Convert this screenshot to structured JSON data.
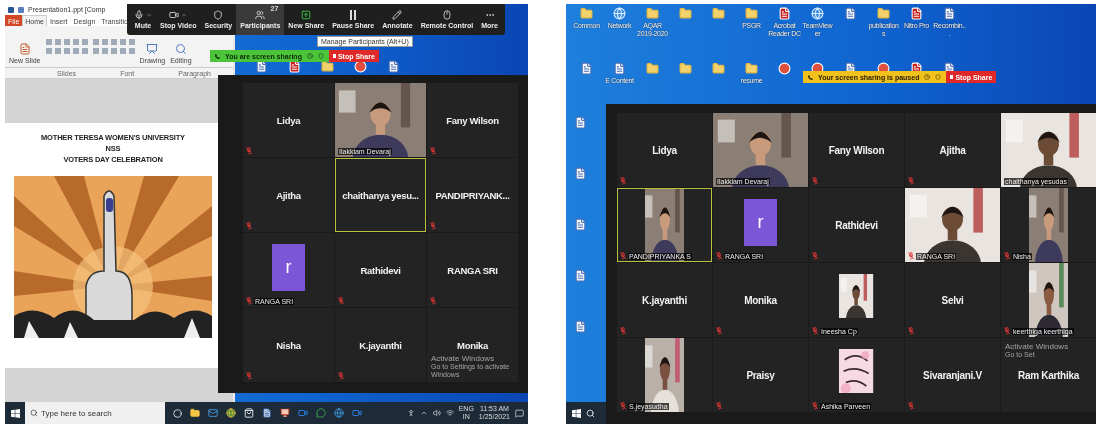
{
  "left": {
    "powerpoint": {
      "title": "Presentation1.ppt [Comp",
      "tabs": [
        {
          "label": "File",
          "selected": false
        },
        {
          "label": "Home",
          "selected": true
        },
        {
          "label": "Insert",
          "selected": false
        },
        {
          "label": "Design",
          "selected": false
        },
        {
          "label": "Transitio",
          "selected": false
        }
      ],
      "ribbon_buttons": [
        "New Slide",
        "Drawing",
        "Editing"
      ],
      "ribbon_groups": [
        "Slides",
        "Font",
        "Paragraph"
      ],
      "slide": {
        "lines": [
          "MOTHER TERESA WOMEN'S UNIVERSITY",
          "NSS",
          "VOTERS DAY CELEBRATION"
        ]
      }
    },
    "toolbar": {
      "buttons": [
        {
          "kind": "mute",
          "label": "Mute",
          "caret": true,
          "hovered": false
        },
        {
          "kind": "video",
          "label": "Stop Video",
          "caret": true,
          "hovered": false
        },
        {
          "kind": "security",
          "label": "Security",
          "caret": false,
          "hovered": false
        },
        {
          "kind": "participants",
          "label": "Participants",
          "caret": false,
          "hovered": true,
          "badge": "27"
        },
        {
          "kind": "new_share",
          "label": "New Share",
          "caret": false,
          "hovered": false
        },
        {
          "kind": "pause_share",
          "label": "Pause Share",
          "caret": false,
          "hovered": false
        },
        {
          "kind": "annotate",
          "label": "Annotate",
          "caret": false,
          "hovered": false
        },
        {
          "kind": "remote_control",
          "label": "Remote Control",
          "caret": false,
          "hovered": false
        },
        {
          "kind": "more",
          "label": "More",
          "caret": false,
          "hovered": false
        }
      ],
      "tooltip": "Manage Participants (Alt+U)"
    },
    "share_bar": {
      "paused": false,
      "message": "You are screen sharing",
      "stop_label": "Stop Share"
    },
    "gallery": {
      "tiles": [
        {
          "kind": "name",
          "name": "Lidya",
          "muted": true,
          "selected": false
        },
        {
          "kind": "video",
          "name": "Ilakkiam Devaraj",
          "muted": false,
          "selected": false
        },
        {
          "kind": "name",
          "name": "Fany Wilson",
          "muted": true,
          "selected": false
        },
        {
          "kind": "name",
          "name": "Ajitha",
          "muted": true,
          "selected": false
        },
        {
          "kind": "name",
          "name": "chaithanya  yesu...",
          "muted": false,
          "selected": true
        },
        {
          "kind": "name",
          "name": "PANDIPRIYANK...",
          "muted": true,
          "selected": false
        },
        {
          "kind": "avatar",
          "name": "RANGA SRI",
          "letter": "r",
          "muted": true,
          "selected": false
        },
        {
          "kind": "name",
          "name": "Rathidevi",
          "muted": true,
          "selected": false
        },
        {
          "kind": "name",
          "name": "RANGA SRI",
          "muted": true,
          "selected": false
        },
        {
          "kind": "name",
          "name": "Nisha",
          "muted": true,
          "selected": false
        },
        {
          "kind": "name",
          "name": "K.jayanthi",
          "muted": true,
          "selected": false
        },
        {
          "kind": "name",
          "name": "Monika",
          "muted": false,
          "selected": false
        }
      ],
      "activation": [
        "Activate Windows",
        "Go to Settings to activate Windows"
      ]
    },
    "taskbar": {
      "placeholder": "Type here to search",
      "language": "ENG",
      "region": "IN",
      "time": "11:53 AM",
      "date": "1/25/2021"
    }
  },
  "right": {
    "desktop_icons": [
      {
        "kind": "folder",
        "label": "Common"
      },
      {
        "kind": "globe",
        "label": "Network"
      },
      {
        "kind": "folder",
        "label": "AQAR 2019-2020"
      },
      {
        "kind": "folder"
      },
      {
        "kind": "folder"
      },
      {
        "kind": "folder",
        "label": "PSGR"
      },
      {
        "kind": "pdf",
        "label": "Acrobat Reader DC"
      },
      {
        "kind": "globe",
        "label": "TeamViewer"
      },
      {
        "kind": "doc"
      },
      {
        "kind": "folder",
        "label": "publications"
      },
      {
        "kind": "pdf",
        "label": "Nitro Pro"
      },
      {
        "kind": "doc",
        "label": "Recombin..."
      },
      {
        "kind": "doc"
      },
      {
        "kind": "doc",
        "label": "E Content"
      },
      {
        "kind": "folder"
      },
      {
        "kind": "folder"
      },
      {
        "kind": "folder"
      },
      {
        "kind": "folder",
        "label": "resume"
      },
      {
        "kind": "app"
      },
      {
        "kind": "app"
      },
      {
        "kind": "doc"
      },
      {
        "kind": "app"
      },
      {
        "kind": "pdf"
      },
      {
        "kind": "doc"
      }
    ],
    "side_icons": [
      {
        "kind": "doc"
      },
      {
        "kind": "doc"
      },
      {
        "kind": "doc"
      },
      {
        "kind": "doc"
      },
      {
        "kind": "doc"
      }
    ],
    "share_bar": {
      "paused": true,
      "message": "Your screen sharing is paused",
      "stop_label": "Stop Share"
    },
    "gallery": {
      "tiles": [
        {
          "kind": "name",
          "name": "Lidya",
          "muted": true,
          "selected": false
        },
        {
          "kind": "video",
          "name": "Ilakkiam Devaraj",
          "muted": false,
          "selected": false
        },
        {
          "kind": "name",
          "name": "Fany Wilson",
          "muted": true,
          "selected": false
        },
        {
          "kind": "name",
          "name": "Ajitha",
          "muted": true,
          "selected": false
        },
        {
          "kind": "video",
          "name": "chaithanya yesudas",
          "muted": false,
          "selected": false
        },
        {
          "kind": "portrait",
          "name": "PANDIPRIYANKA S",
          "muted": true,
          "selected": true
        },
        {
          "kind": "avatar",
          "name": "RANGA SRI",
          "letter": "r",
          "muted": true,
          "selected": false
        },
        {
          "kind": "name",
          "name": "Rathidevi",
          "muted": true,
          "selected": false
        },
        {
          "kind": "video",
          "name": "RANGA SRI",
          "muted": true,
          "selected": false
        },
        {
          "kind": "portrait",
          "name": "Nisha",
          "muted": true,
          "selected": false
        },
        {
          "kind": "name",
          "name": "K.jayanthi",
          "muted": true,
          "selected": false
        },
        {
          "kind": "name",
          "name": "Monika",
          "muted": true,
          "selected": false
        },
        {
          "kind": "thumbnail",
          "name": "Ineesha Cp",
          "muted": true,
          "selected": false
        },
        {
          "kind": "name",
          "name": "Selvi",
          "muted": true,
          "selected": false
        },
        {
          "kind": "portrait",
          "name": "keerthiga keerthiga",
          "muted": true,
          "selected": false
        },
        {
          "kind": "portrait",
          "name": "S.jeyasudha",
          "muted": true,
          "selected": false
        },
        {
          "kind": "name",
          "name": "Praisy",
          "muted": true,
          "selected": false
        },
        {
          "kind": "thumbnail",
          "name": "Ashika Parveen",
          "muted": true,
          "selected": false
        },
        {
          "kind": "name",
          "name": "Sivaranjani.V",
          "muted": true,
          "selected": false
        },
        {
          "kind": "name",
          "name": "Ram Karthika",
          "muted": false,
          "selected": false
        }
      ],
      "activation": [
        "Activate Windows",
        "Go to Set"
      ]
    }
  }
}
